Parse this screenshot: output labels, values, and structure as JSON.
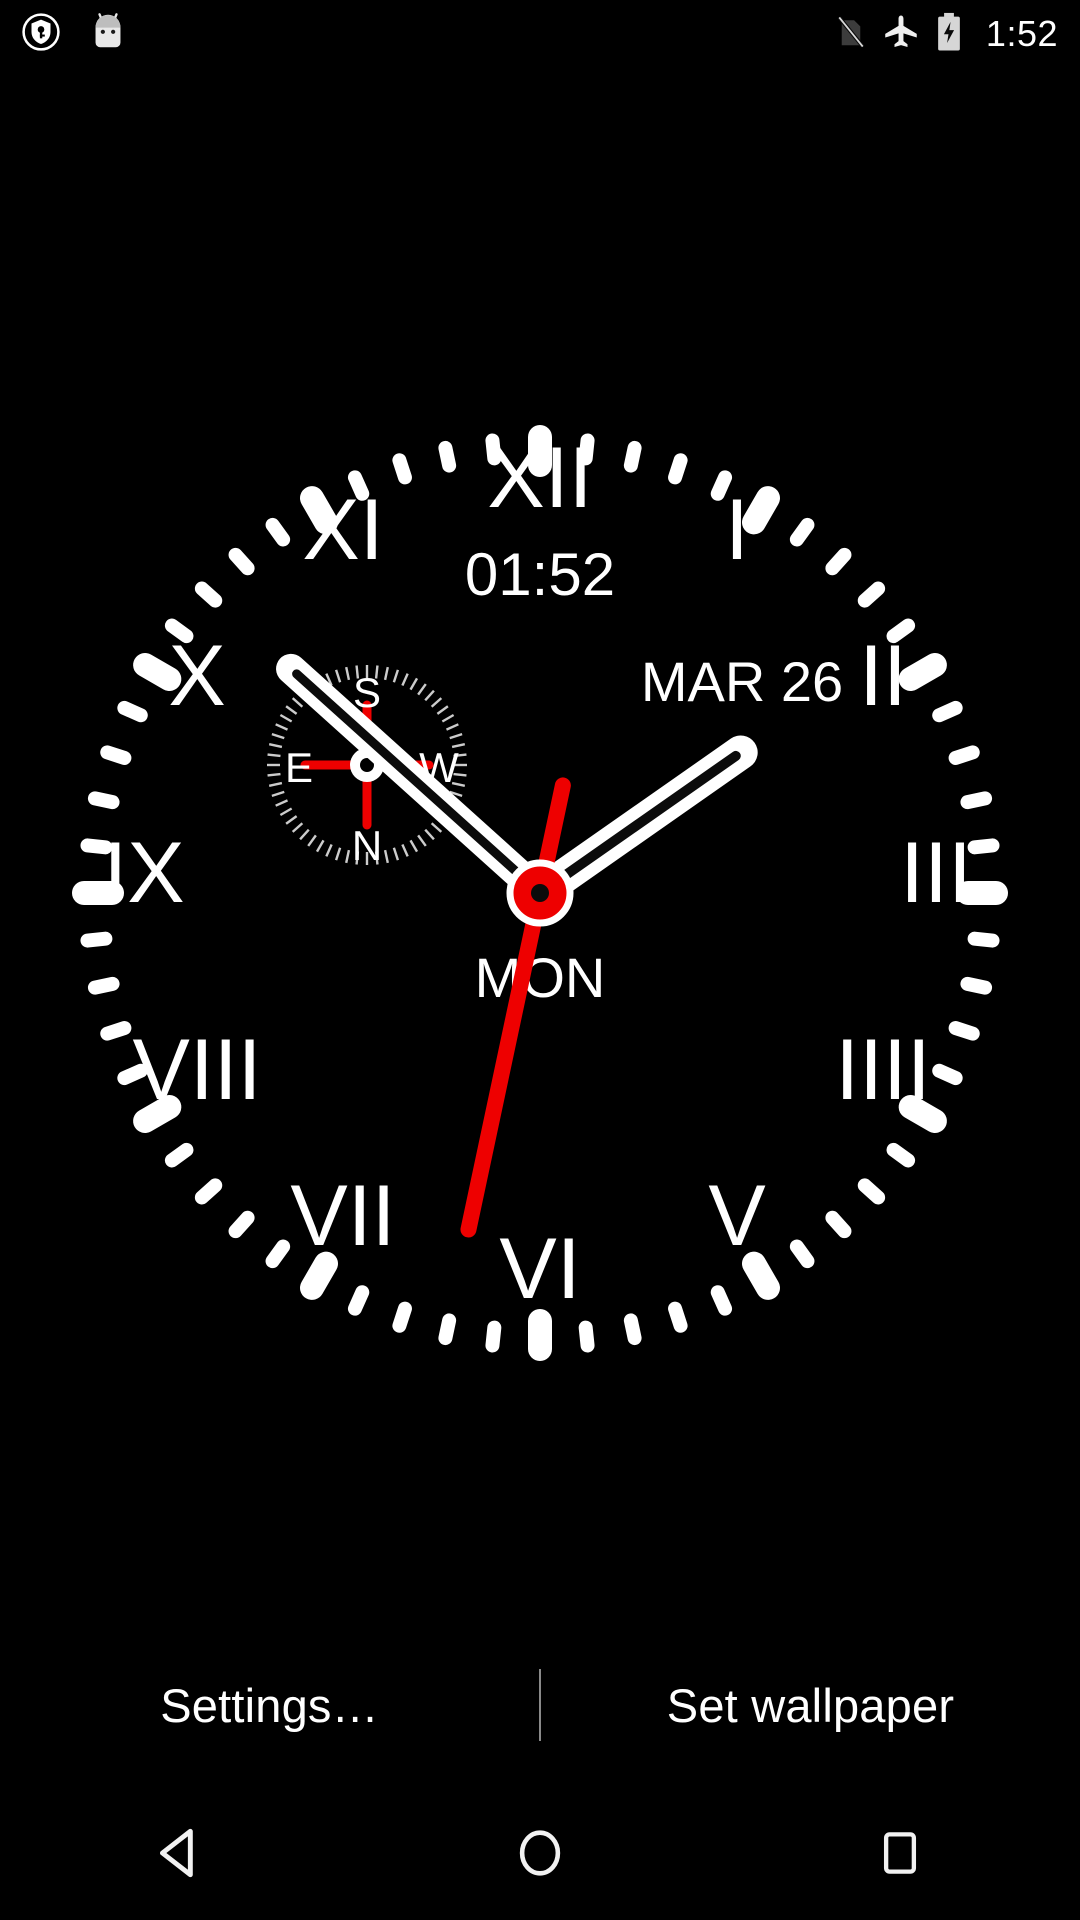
{
  "status_bar": {
    "left_icons": [
      {
        "name": "vpn-key-shield-icon",
        "label": "VPN active"
      },
      {
        "name": "android-head-icon",
        "label": "Android system"
      }
    ],
    "right_icons": [
      {
        "name": "no-sim-signal-off-icon",
        "label": "No SIM / signal off"
      },
      {
        "name": "airplane-mode-icon",
        "label": "Airplane mode on"
      },
      {
        "name": "battery-charging-icon",
        "label": "Battery charging"
      }
    ],
    "clock": "1:52"
  },
  "wallpaper": {
    "background_color": "#000000",
    "clock": {
      "digital_time": "01:52",
      "date": "MAR 26",
      "weekday": "MON",
      "hour_numerals": [
        "XII",
        "I",
        "II",
        "III",
        "IIII",
        "V",
        "VI",
        "VII",
        "VIII",
        "IX",
        "X",
        "XI"
      ],
      "hands": {
        "hour_angle_deg": 55,
        "minute_angle_deg": 312,
        "second_angle_deg": 192,
        "hand_color": "#ffffff",
        "second_hand_color": "#ee0000",
        "hub_color": "#ee0000"
      },
      "compass": {
        "labels": {
          "top": "S",
          "right": "W",
          "bottom": "N",
          "left": "E"
        },
        "needle_color": "#ee0000",
        "ring_color": "#ffffff"
      }
    }
  },
  "actions": {
    "settings_label": "Settings…",
    "set_wallpaper_label": "Set wallpaper"
  },
  "nav_bar": {
    "back": "back-button",
    "home": "home-button",
    "recents": "recents-button"
  }
}
